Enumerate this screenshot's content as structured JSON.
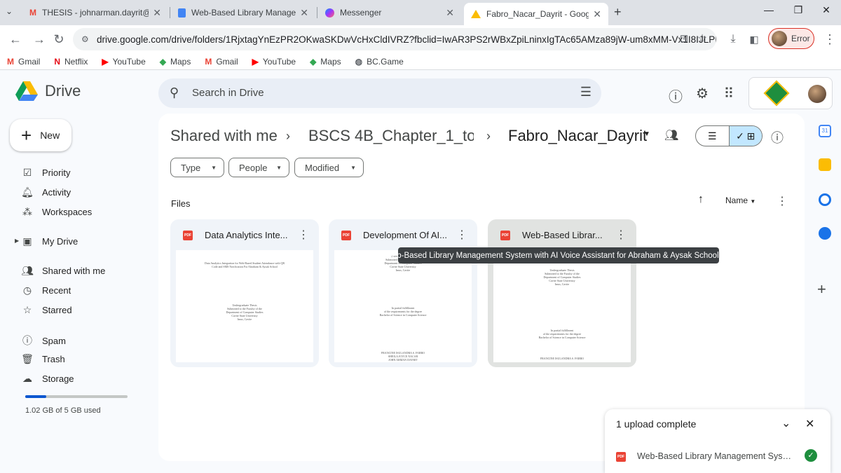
{
  "browser": {
    "tabs": [
      {
        "label": "THESIS - johnarman.dayrit@cvs",
        "icon": "gmail-icon"
      },
      {
        "label": "Web-Based Library Manageme",
        "icon": "docs-icon"
      },
      {
        "label": "Messenger",
        "icon": "messenger-icon"
      },
      {
        "label": "Fabro_Nacar_Dayrit - Google D",
        "icon": "drive-icon"
      }
    ],
    "url": "drive.google.com/drive/folders/1RjxtagYnEzPR2OKwaSKDwVcHxCldIVRZ?fbclid=IwAR3PS2rWBxZpiLninxIgTAc65AMza89jW-um8xMM-Vx1I8IJLPMG2Yc...",
    "profile_label": "Error",
    "bookmarks": [
      {
        "label": "Gmail",
        "icon": "gmail-icon"
      },
      {
        "label": "Netflix",
        "icon": "netflix-icon"
      },
      {
        "label": "YouTube",
        "icon": "youtube-icon"
      },
      {
        "label": "Maps",
        "icon": "maps-icon"
      },
      {
        "label": "Gmail",
        "icon": "gmail-icon"
      },
      {
        "label": "YouTube",
        "icon": "youtube-icon"
      },
      {
        "label": "Maps",
        "icon": "maps-icon"
      },
      {
        "label": "BC.Game",
        "icon": "globe-icon"
      }
    ]
  },
  "drive": {
    "app_name": "Drive",
    "search_placeholder": "Search in Drive",
    "new_label": "New",
    "nav": [
      {
        "label": "Priority",
        "icon": "priority-icon"
      },
      {
        "label": "Activity",
        "icon": "bell-icon"
      },
      {
        "label": "Workspaces",
        "icon": "workspaces-icon"
      },
      {
        "label": "My Drive",
        "icon": "my-drive-icon"
      },
      {
        "label": "Shared with me",
        "icon": "shared-icon"
      },
      {
        "label": "Recent",
        "icon": "clock-icon"
      },
      {
        "label": "Starred",
        "icon": "star-icon"
      },
      {
        "label": "Spam",
        "icon": "spam-icon"
      },
      {
        "label": "Trash",
        "icon": "trash-icon"
      },
      {
        "label": "Storage",
        "icon": "cloud-icon"
      }
    ],
    "storage_text": "1.02 GB of 5 GB used",
    "storage_fraction": 0.204,
    "breadcrumb": [
      "Shared with me",
      "BSCS 4B_Chapter_1_to...",
      "Fabro_Nacar_Dayrit"
    ],
    "filters": [
      "Type",
      "People",
      "Modified"
    ],
    "section_label": "Files",
    "sort_label": "Name",
    "files": [
      {
        "name": "Data Analytics Inte...",
        "thumb": [
          "Data Analytics Integration for Web-Based Student Attendance with QR",
          "Code and SMS Notification For Abraham & Aysak School",
          "",
          "Undergraduate Thesis",
          "Submitted to the Faculty of the",
          "Department of Computer Studies",
          "Cavite State University",
          "Imus, Cavite"
        ]
      },
      {
        "name": "Development Of AI...",
        "thumb": [
          "Undergraduate Thesis",
          "Submitted to the Faculty of the",
          "Department of Computer Studies",
          "Cavite State University",
          "Imus, Cavite",
          "",
          "In partial fulfillment",
          "of the requirements for the degree",
          "Bachelor of Science in Computer Science",
          "",
          "FRANCINE ISULANDRA S. FABRO",
          "SHEILA JOYCE NACAR",
          "JOHN ARMAN DAYRIT"
        ]
      },
      {
        "name": "Web-Based Librar...",
        "thumb": [
          "Undergraduate Thesis",
          "Submitted to the Faculty of the",
          "Department of Computer Studies",
          "Cavite State University",
          "Imus, Cavite",
          "",
          "In partial fulfillment",
          "of the requirements for the degree",
          "Bachelor of Science in Computer Science",
          "",
          "FRANCINE ISULANDRA S. FABRO"
        ]
      }
    ],
    "tooltip": "Web-Based Library Management System with AI Voice Assistant for Abraham & Aysak School.pdf",
    "upload": {
      "title": "1 upload complete",
      "file": "Web-Based Library Management System with AI Voice Assistant for Abraham & Aysak School.pdf"
    }
  },
  "colors": {
    "accent": "#0b57d0",
    "selected_view": "#c2e7ff",
    "pdf_red": "#ea4335",
    "success": "#1e8e3e"
  }
}
